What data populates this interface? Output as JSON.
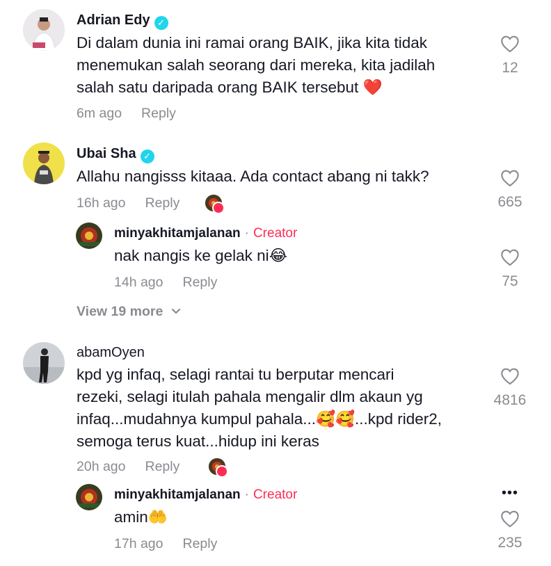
{
  "comments": [
    {
      "username": "Adrian Edy",
      "verified": true,
      "text_lines": [
        "Di dalam dunia ini ramai orang BAIK, jika kita tidak",
        "menemukan salah seorang dari mereka, kita jadilah",
        "salah satu daripada orang BAIK tersebut ❤️"
      ],
      "time": "6m ago",
      "reply_label": "Reply",
      "likes": "12"
    },
    {
      "username": "Ubai Sha",
      "verified": true,
      "text_lines": [
        "Allahu nangisss kitaaa. Ada contact abang ni takk?"
      ],
      "time": "16h ago",
      "reply_label": "Reply",
      "likes": "665",
      "reply": {
        "username": "minyakhitamjalanan",
        "badge": "Creator",
        "text": "nak nangis ke gelak ni😂",
        "time": "14h ago",
        "reply_label": "Reply",
        "likes": "75"
      },
      "view_more": "View 19 more"
    },
    {
      "username": "abamOyen",
      "verified": false,
      "text_lines": [
        "kpd yg infaq, selagi rantai tu berputar mencari",
        "rezeki, selagi itulah pahala mengalir dlm akaun yg",
        "infaq...mudahnya kumpul pahala...🥰🥰...kpd rider2,",
        "semoga terus kuat...hidup ini keras"
      ],
      "time": "20h ago",
      "reply_label": "Reply",
      "likes": "4816",
      "reply": {
        "username": "minyakhitamjalanan",
        "badge": "Creator",
        "text": "amin🤲",
        "time": "17h ago",
        "reply_label": "Reply",
        "likes": "235"
      }
    }
  ],
  "more_options": "•••",
  "colors": {
    "accent": "#FE2C55",
    "verified": "#20D5EC",
    "muted": "#8A8B91"
  }
}
